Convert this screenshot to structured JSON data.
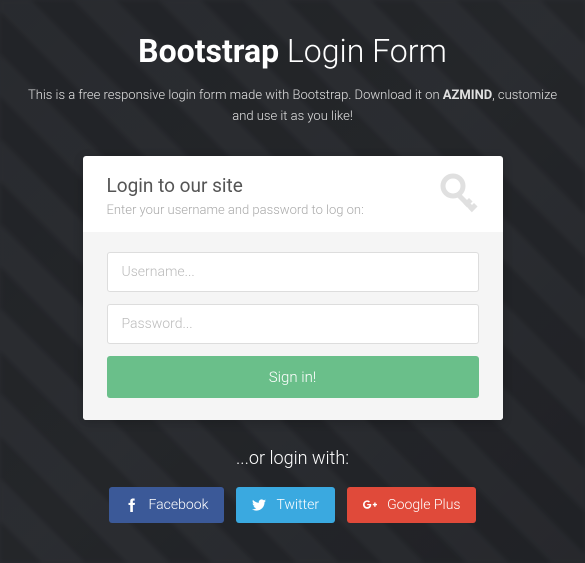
{
  "header": {
    "title_bold": "Bootstrap",
    "title_light": "Login Form",
    "subtitle_pre": "This is a free responsive login form made with Bootstrap. Download it on ",
    "subtitle_bold": "AZMIND",
    "subtitle_post": ", customize and use it as you like!"
  },
  "card": {
    "title": "Login to our site",
    "subtitle": "Enter your username and password to log on:",
    "username_placeholder": "Username...",
    "password_placeholder": "Password...",
    "signin_label": "Sign in!"
  },
  "icons": {
    "key": "key-icon"
  },
  "social": {
    "or_label": "...or login with:",
    "facebook_label": "Facebook",
    "twitter_label": "Twitter",
    "google_label": "Google Plus"
  },
  "colors": {
    "accent_green": "#6abf8a",
    "facebook": "#3b5998",
    "twitter": "#3aa9e0",
    "googleplus": "#e04a3a"
  }
}
